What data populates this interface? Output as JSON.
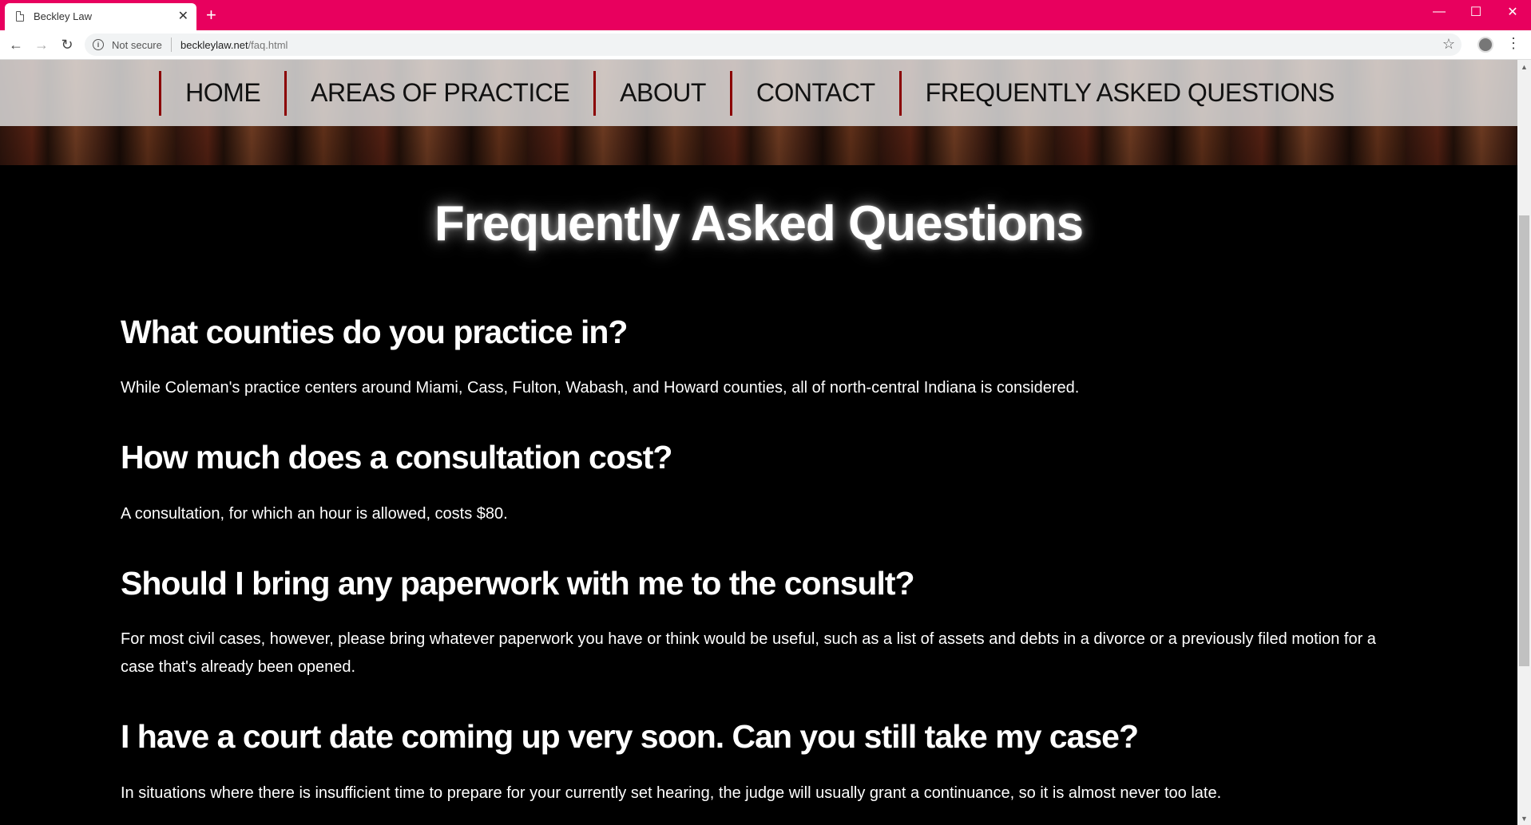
{
  "browser": {
    "tab_title": "Beckley Law",
    "tab_close": "✕",
    "new_tab": "+",
    "window_controls": {
      "minimize": "—",
      "maximize": "☐",
      "close": "✕"
    },
    "not_secure_label": "Not secure",
    "url_host": "beckleylaw.net",
    "url_path": "/faq.html",
    "icons": {
      "back": "←",
      "forward": "→",
      "reload": "↻",
      "star": "☆",
      "menu": "⋮",
      "info": "i"
    }
  },
  "nav": {
    "items": [
      "HOME",
      "AREAS OF PRACTICE",
      "ABOUT",
      "CONTACT",
      "FREQUENTLY ASKED QUESTIONS"
    ],
    "divider_color": "#8b0000"
  },
  "page": {
    "title": "Frequently Asked Questions",
    "faqs": [
      {
        "question": "What counties do you practice in?",
        "answer": "While Coleman's practice centers around Miami, Cass, Fulton, Wabash, and Howard counties, all of north-central Indiana is considered."
      },
      {
        "question": "How much does a consultation cost?",
        "answer": "A consultation, for which an hour is allowed, costs $80."
      },
      {
        "question": "Should I bring any paperwork with me to the consult?",
        "answer": "For most civil cases, however, please bring whatever paperwork you have or think would be useful, such as a list of assets and debts in a divorce or a previously filed motion for a case that's already been opened."
      },
      {
        "question": "I have a court date coming up very soon. Can you still take my case?",
        "answer": "In situations where there is insufficient time to prepare for your currently set hearing, the judge will usually grant a continuance, so it is almost never too late."
      }
    ]
  },
  "colors": {
    "browser_frame": "#e8005e",
    "page_background": "#000000",
    "text": "#ffffff"
  }
}
